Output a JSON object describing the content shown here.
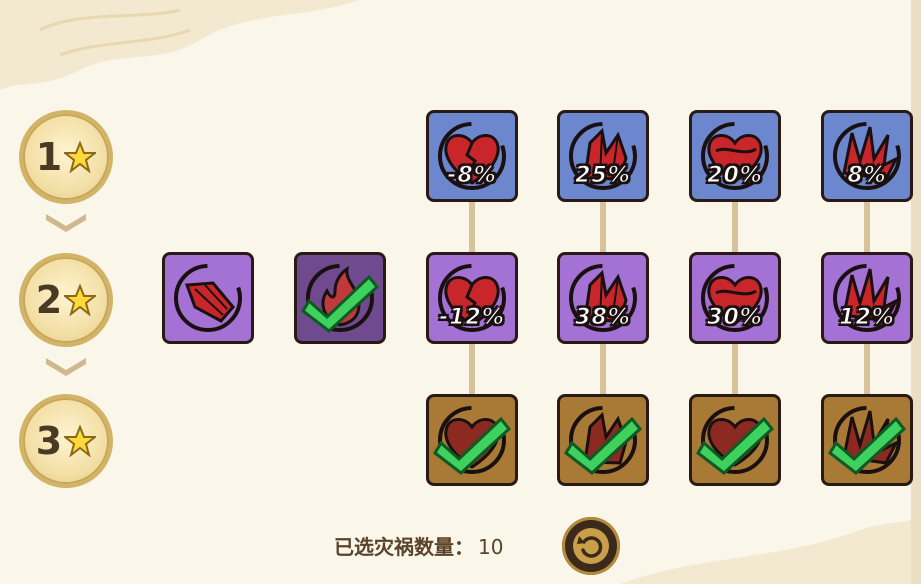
{
  "tiers": [
    {
      "number": "1"
    },
    {
      "number": "2"
    },
    {
      "number": "3"
    }
  ],
  "rows": {
    "tier1": [
      {
        "icon": "broken-heart-icon",
        "value": "-8%"
      },
      {
        "icon": "crystal-cluster-icon",
        "value": "25%"
      },
      {
        "icon": "bleeding-heart-icon",
        "value": "20%"
      },
      {
        "icon": "spike-burst-icon",
        "value": "8%"
      }
    ],
    "tier2": [
      {
        "icon": "crystal-shard-icon",
        "value": ""
      },
      {
        "icon": "flame-icon",
        "value": "",
        "selected": true
      },
      {
        "icon": "broken-heart-icon",
        "value": "-12%"
      },
      {
        "icon": "crystal-cluster-icon",
        "value": "38%"
      },
      {
        "icon": "bleeding-heart-icon",
        "value": "30%"
      },
      {
        "icon": "spike-burst-icon",
        "value": "12%"
      }
    ],
    "tier3": [
      {
        "icon": "broken-heart-icon",
        "value": "",
        "selected": true
      },
      {
        "icon": "crystal-cluster-icon",
        "value": "",
        "selected": true
      },
      {
        "icon": "bleeding-heart-icon",
        "value": "",
        "selected": true
      },
      {
        "icon": "spike-burst-icon",
        "value": "",
        "selected": true
      }
    ]
  },
  "footer": {
    "label": "已选灾祸数量：",
    "count": "10"
  },
  "colors": {
    "tier1_card": "#6d87cf",
    "tier2_card": "#a472d4",
    "tier3_card": "#a97a35",
    "check": "#3fd15e",
    "icon_red": "#c8262a"
  }
}
